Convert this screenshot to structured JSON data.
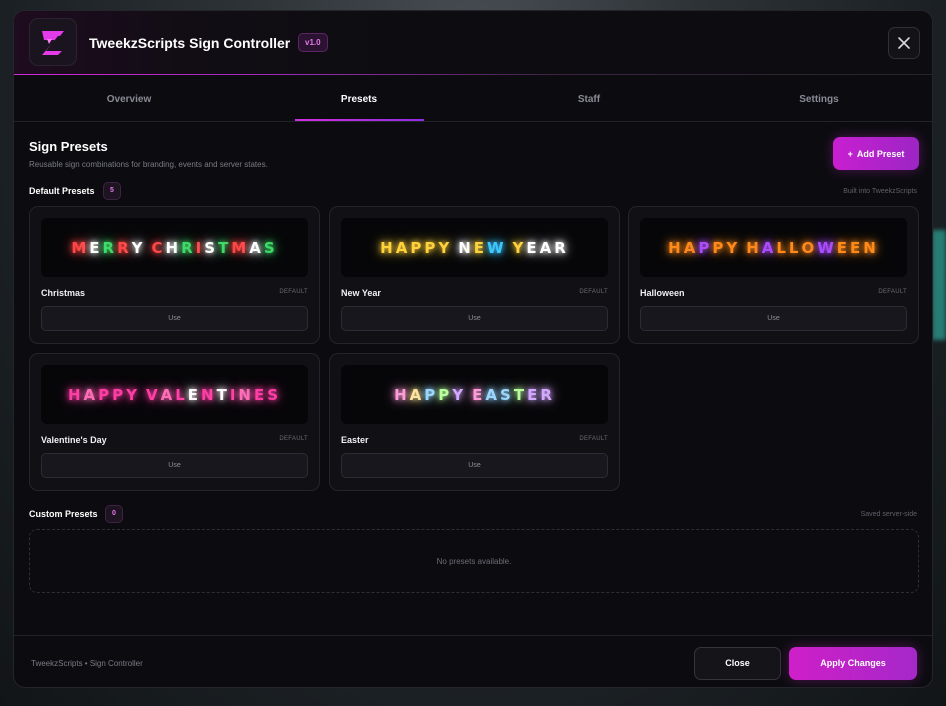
{
  "colors": {
    "accent": "#c81fd0",
    "accent2": "#9c25c4",
    "background": "#0c0c10"
  },
  "header": {
    "title": "TweekzScripts Sign Controller",
    "version": "v1.0",
    "logo_icon": "lightning-z-logo",
    "close_icon": "close-icon"
  },
  "tabs": [
    {
      "label": "Overview",
      "active": false
    },
    {
      "label": "Presets",
      "active": true
    },
    {
      "label": "Staff",
      "active": false
    },
    {
      "label": "Settings",
      "active": false
    }
  ],
  "section": {
    "title": "Sign Presets",
    "subtitle": "Reusable sign combinations for branding, events and server states.",
    "add_button": "Add Preset",
    "add_icon": "+"
  },
  "default_presets": {
    "label": "Default Presets",
    "count": "5",
    "note": "Built into TweekzScripts",
    "cards": [
      {
        "name": "Christmas",
        "tag": "DEFAULT",
        "use_label": "Use",
        "sign": "MERRY CHRISTMAS",
        "letter_colors": [
          "#ff4545",
          "#ffffff",
          "#3ddc6a",
          "#ff4545",
          "#ffffff",
          " ",
          "#ff4545",
          "#ffffff",
          "#3ddc6a",
          "#ff4545",
          "#ffffff",
          "#3ddc6a",
          "#ff4545",
          "#ffffff",
          "#3ddc6a"
        ]
      },
      {
        "name": "New Year",
        "tag": "DEFAULT",
        "use_label": "Use",
        "sign": "HAPPY NEW YEAR",
        "letter_colors": [
          "#ffd23c",
          "#ffd23c",
          "#ffd23c",
          "#ffd23c",
          "#ffd23c",
          " ",
          "#ffffff",
          "#ffd23c",
          "#3ec7ff",
          " ",
          "#ffd23c",
          "#ffffff",
          "#ffffff",
          "#ffffff"
        ]
      },
      {
        "name": "Halloween",
        "tag": "DEFAULT",
        "use_label": "Use",
        "sign": "HAPPY HALLOWEEN",
        "letter_colors": [
          "#ff8a1a",
          "#ff8a1a",
          "#a94bff",
          "#ff8a1a",
          "#ff8a1a",
          " ",
          "#ff8a1a",
          "#a94bff",
          "#ff8a1a",
          "#ff8a1a",
          "#ff8a1a",
          "#a94bff",
          "#ff8a1a",
          "#ff8a1a",
          "#ff8a1a"
        ]
      },
      {
        "name": "Valentine's Day",
        "tag": "DEFAULT",
        "use_label": "Use",
        "sign": "HAPPY VALENTINES",
        "letter_colors": [
          "#ff3ea5",
          "#ff6fb9",
          "#ff3ea5",
          "#ff3ea5",
          "#ff3ea5",
          " ",
          "#ff3ea5",
          "#ff6fb9",
          "#ff3ea5",
          "#ffffff",
          "#ff3ea5",
          "#ffffff",
          "#ff3ea5",
          "#ff6fb9",
          "#ff3ea5",
          "#ff3ea5"
        ]
      },
      {
        "name": "Easter",
        "tag": "DEFAULT",
        "use_label": "Use",
        "sign": "HAPPY EASTER",
        "letter_colors": [
          "#ff9ad9",
          "#ffe59a",
          "#9ad7ff",
          "#b8ff9a",
          "#d4a8ff",
          " ",
          "#ff9ad9",
          "#9ad7ff",
          "#9ad7ff",
          "#b8ff9a",
          "#d4a8ff",
          "#d4a8ff"
        ]
      }
    ]
  },
  "custom_presets": {
    "label": "Custom Presets",
    "count": "0",
    "note": "Saved server-side",
    "empty_text": "No presets available."
  },
  "footer": {
    "text": "TweekzScripts • Sign Controller",
    "close_label": "Close",
    "apply_label": "Apply Changes"
  }
}
